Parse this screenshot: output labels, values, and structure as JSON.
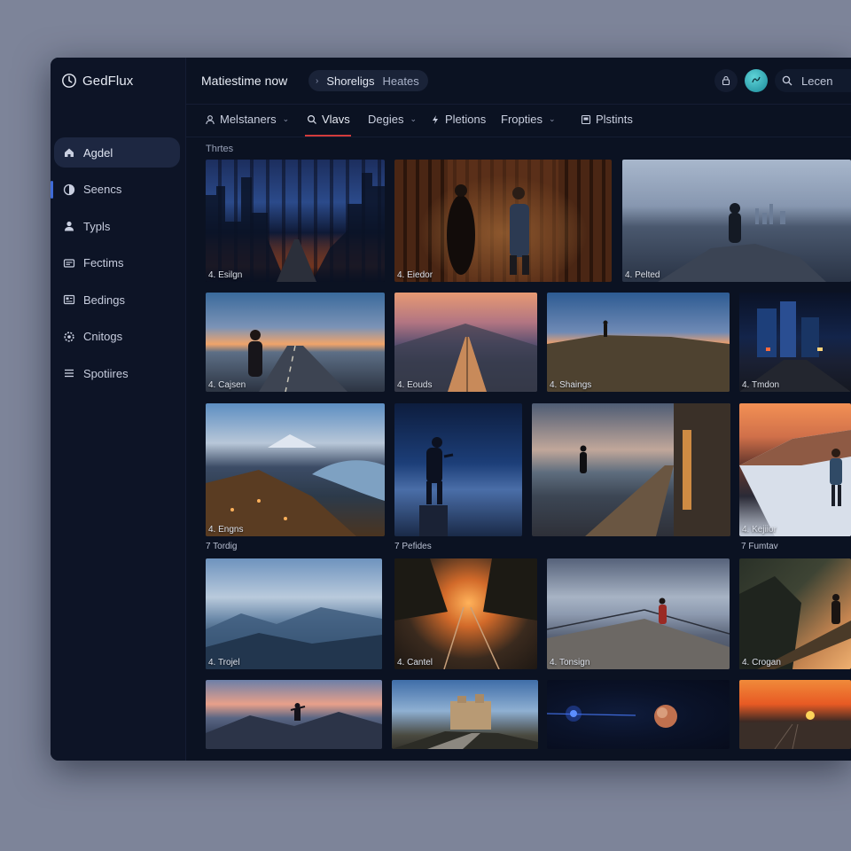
{
  "app": {
    "name": "GedFlux"
  },
  "header": {
    "title": "Matiestime now",
    "pill_primary": "Shoreligs",
    "pill_secondary": "Heates",
    "search_label": "Lecen"
  },
  "sidebar": {
    "items": [
      {
        "label": "Agdel",
        "icon": "home-icon"
      },
      {
        "label": "Seencs",
        "icon": "half-circle-icon"
      },
      {
        "label": "Typls",
        "icon": "user-icon"
      },
      {
        "label": "Fectims",
        "icon": "card-icon"
      },
      {
        "label": "Bedings",
        "icon": "gallery-icon"
      },
      {
        "label": "Cnitogs",
        "icon": "gear-icon"
      },
      {
        "label": "Spotiires",
        "icon": "list-icon"
      }
    ]
  },
  "tabs": [
    {
      "label": "Melstaners",
      "icon": "user-icon",
      "dropdown": true
    },
    {
      "label": "Vlavs",
      "icon": "search-icon",
      "dropdown": false
    },
    {
      "label": "Degies",
      "icon": "",
      "dropdown": true
    },
    {
      "label": "Pletions",
      "icon": "bolt-icon",
      "dropdown": false
    },
    {
      "label": "Fropties",
      "icon": "",
      "dropdown": true
    },
    {
      "label": "Plstints",
      "icon": "image-icon",
      "dropdown": false
    }
  ],
  "section_label": "Thrtes",
  "photos": [
    {
      "caption": "4. Esilgn"
    },
    {
      "caption": "4. Eiedor"
    },
    {
      "caption": "4. Pelted"
    },
    {
      "caption": "4. Cajsen"
    },
    {
      "caption": "4. Eouds"
    },
    {
      "caption": "4. Shaings"
    },
    {
      "caption": "4. Tmdon"
    },
    {
      "caption": "4. Engns",
      "subcaption": "7 Tordig"
    },
    {
      "caption": "",
      "subcaption": "7 Pefides"
    },
    {
      "caption": ""
    },
    {
      "caption": "4. Kejiior",
      "subcaption": "7 Fumtav"
    },
    {
      "caption": "4. Trojel"
    },
    {
      "caption": "4. Cantel"
    },
    {
      "caption": "4. Tonsign"
    },
    {
      "caption": "4. Crogan"
    },
    {
      "caption": ""
    },
    {
      "caption": ""
    },
    {
      "caption": ""
    },
    {
      "caption": ""
    }
  ],
  "colors": {
    "accent": "#d23b3b",
    "active_marker": "#3f6bd8",
    "background": "#0b1222"
  }
}
